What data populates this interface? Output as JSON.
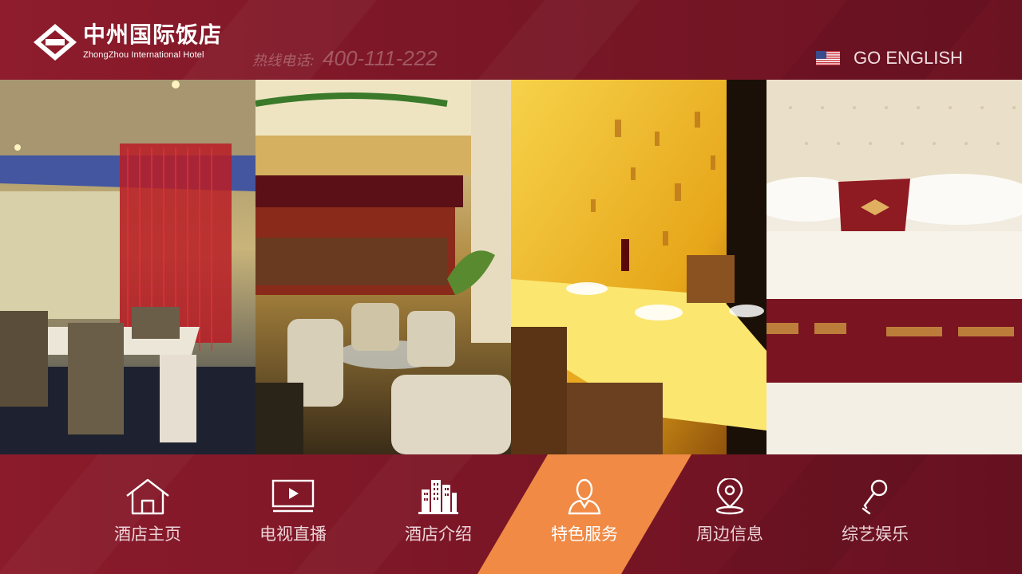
{
  "header": {
    "logo_cn": "中州国际饭店",
    "logo_en": "ZhongZhou International Hotel",
    "hotline_label": "热线电话:",
    "hotline_number": "400-111-222",
    "language_label": "GO ENGLISH"
  },
  "colors": {
    "brand": "#8e1c2c",
    "active": "#f08a45"
  },
  "nav": {
    "items": [
      {
        "label": "酒店主页",
        "icon": "home-icon"
      },
      {
        "label": "电视直播",
        "icon": "tv-play-icon"
      },
      {
        "label": "酒店介绍",
        "icon": "building-icon"
      },
      {
        "label": "特色服务",
        "icon": "service-person-icon",
        "active": true
      },
      {
        "label": "周边信息",
        "icon": "location-pin-icon"
      },
      {
        "label": "综艺娱乐",
        "icon": "microphone-icon"
      }
    ]
  }
}
